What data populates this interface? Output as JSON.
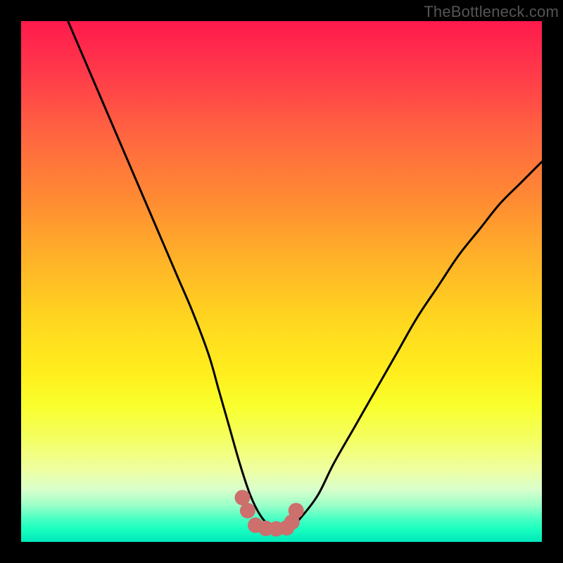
{
  "watermark": "TheBottleneck.com",
  "colors": {
    "frame": "#000000",
    "gradient_top": "#ff1a4d",
    "gradient_bottom": "#00e8bb",
    "curve": "#000000",
    "marker": "#cc6f6d"
  },
  "chart_data": {
    "type": "line",
    "title": "",
    "xlabel": "",
    "ylabel": "",
    "xlim": [
      0,
      100
    ],
    "ylim": [
      0,
      100
    ],
    "grid": false,
    "legend": false,
    "series": [
      {
        "name": "bottleneck-curve",
        "x": [
          9,
          12,
          15,
          18,
          21,
          24,
          27,
          30,
          33,
          36,
          38,
          40,
          42,
          44,
          46,
          48,
          50,
          52,
          54,
          57,
          60,
          64,
          68,
          72,
          76,
          80,
          84,
          88,
          92,
          96,
          100
        ],
        "y": [
          100,
          93,
          86,
          79,
          72,
          65,
          58,
          51,
          44,
          36,
          29,
          22,
          15,
          9,
          5,
          3,
          2.5,
          3,
          5,
          9,
          15,
          22,
          29,
          36,
          43,
          49,
          55,
          60,
          65,
          69,
          73
        ]
      }
    ],
    "markers": {
      "name": "highlight-points",
      "x": [
        42.5,
        43.5,
        45,
        47,
        49,
        51,
        52,
        52.8
      ],
      "y": [
        8.5,
        6,
        3.2,
        2.6,
        2.5,
        2.7,
        3.8,
        6
      ]
    }
  }
}
